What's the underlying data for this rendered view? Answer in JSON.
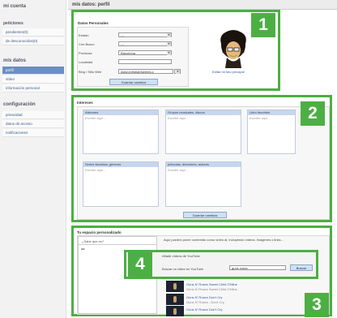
{
  "sidebar": {
    "account_title": "mi cuenta",
    "requests_title": "peticiones",
    "requests": [
      "pendientes(0)",
      "de desconocidos(0)"
    ],
    "mydata_title": "mis datos",
    "mydata": [
      "perfil",
      "vídeo",
      "información personal"
    ],
    "config_title": "configuración",
    "config": [
      "privacidad",
      "datos de acceso",
      "notificaciones"
    ]
  },
  "header": {
    "title": "mis datos: perfil"
  },
  "personal": {
    "title": "Datos Personales",
    "fields": [
      {
        "label": "Estado",
        "value": "---"
      },
      {
        "label": "Con Busco",
        "value": "---"
      },
      {
        "label": "Provincia",
        "value": "Barcelona"
      },
      {
        "label": "Localidad",
        "value": ""
      },
      {
        "label": "Blog / Sitio Web",
        "value": "www.christianfuentes.c"
      }
    ],
    "save": "Guardar cambios",
    "change_photo": "Editar mi foto principal"
  },
  "interests": {
    "title": "Intereses",
    "boxes": [
      {
        "head": "Aficiones",
        "placeholder": "Escribe aquí..."
      },
      {
        "head": "Grupos musicales, discos",
        "placeholder": "Escribe aquí..."
      },
      {
        "head": "Libro favoritos",
        "placeholder": "Escribe aquí..."
      },
      {
        "head": "Series favoritas, géneros",
        "placeholder": "Escribe aquí..."
      },
      {
        "head": "películas, directores, actores",
        "placeholder": "Escribe aquí..."
      }
    ],
    "save": "Guardar cambios"
  },
  "custom": {
    "title": "Tu espacio personalizado",
    "side_label": "¿Sabe que es?",
    "side_value": "aa",
    "help": "Aquí puedes poner contenido como vídeo al, incluyendo vídeos, imágenes o links...",
    "add_video": "Añadir vídeos de YouTube",
    "search_label": "Buscar un video en YouTube",
    "search_value": "guns roses",
    "search_btn": "Buscar",
    "videos": [
      {
        "title": "Guns N' Roses Sweet Child O'Mine",
        "sub": "Guns N' Roses Sweet Child O'Mine"
      },
      {
        "title": "Guns N' Roses Don't Cry",
        "sub": "Guns N' Roses - Don't Cry"
      },
      {
        "title": "Guns N' Roses Don't Cry",
        "sub": "Guns N' Roses - Don't Cry"
      }
    ]
  },
  "badges": [
    "1",
    "2",
    "3",
    "4"
  ],
  "colors": {
    "accent_green": "#4caf43",
    "link_blue": "#2a56a0"
  }
}
